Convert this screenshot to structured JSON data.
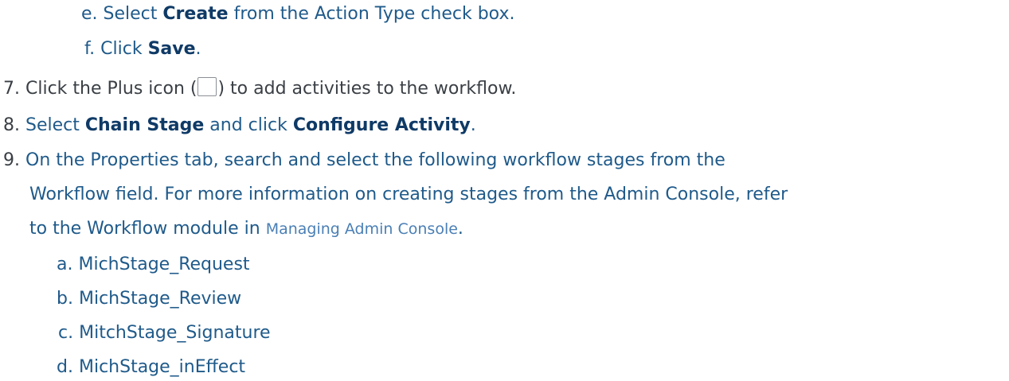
{
  "steps": {
    "e": {
      "marker": "e.",
      "before": "Select ",
      "bold": "Create",
      "after": " from the Action Type check box."
    },
    "f": {
      "marker": "f.",
      "before": "Click ",
      "bold": "Save",
      "after": "."
    },
    "s7": {
      "marker": "7.",
      "before": "Click the Plus icon (",
      "icon": "plus-box-icon",
      "after": ") to add activities to the workflow."
    },
    "s8": {
      "marker": "8.",
      "before": "Select ",
      "bold1": "Chain Stage",
      "middle": " and click ",
      "bold2": "Configure Activity",
      "after": "."
    },
    "s9": {
      "marker": "9.",
      "line1": "On the Properties tab, search and select the following workflow stages from the",
      "line2": "Workflow field. For more information on creating stages from the Admin Console, refer",
      "line3_before": "to the Workflow module in ",
      "line3_link": "Managing Admin Console",
      "line3_after": "."
    },
    "sub": [
      {
        "marker": "a.",
        "text": "MichStage_Request"
      },
      {
        "marker": "b.",
        "text": "MichStage_Review"
      },
      {
        "marker": "c.",
        "text": "MitchStage_Signature"
      },
      {
        "marker": "d.",
        "text": "MichStage_inEffect"
      }
    ]
  },
  "colors": {
    "text_blue": "#1f5a8a",
    "text_dark": "#3a3f45",
    "bold_navy": "#0f3a66",
    "link": "#4a7fb5"
  }
}
